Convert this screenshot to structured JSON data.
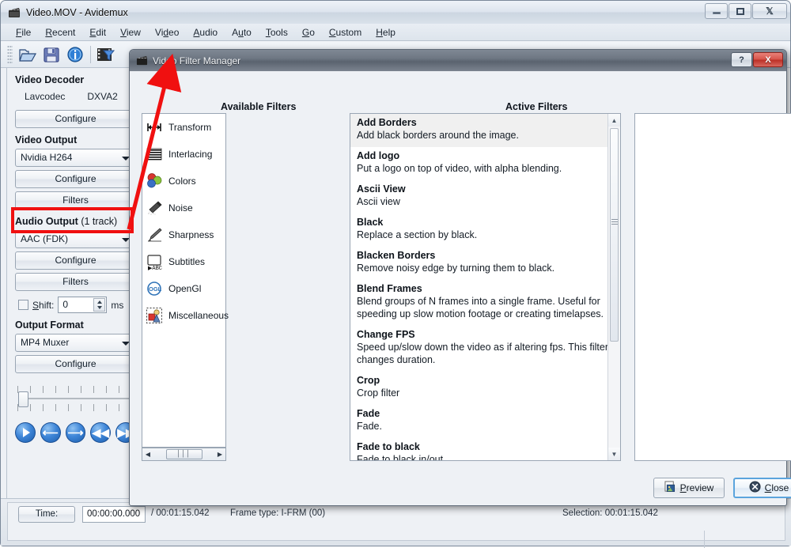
{
  "app": {
    "title": "Video.MOV - Avidemux",
    "icon": "film-clapper-icon",
    "window_buttons": {
      "minimize": "minimize-icon",
      "maximize": "maximize-icon",
      "close": "close-icon"
    },
    "menu": [
      {
        "label": "File",
        "mnemonic": "F"
      },
      {
        "label": "Recent",
        "mnemonic": "R"
      },
      {
        "label": "Edit",
        "mnemonic": "E"
      },
      {
        "label": "View",
        "mnemonic": "V"
      },
      {
        "label": "Video",
        "mnemonic": "d"
      },
      {
        "label": "Audio",
        "mnemonic": "A"
      },
      {
        "label": "Auto",
        "mnemonic": "u"
      },
      {
        "label": "Tools",
        "mnemonic": "T"
      },
      {
        "label": "Go",
        "mnemonic": "G"
      },
      {
        "label": "Custom",
        "mnemonic": "C"
      },
      {
        "label": "Help",
        "mnemonic": "H"
      }
    ],
    "toolbar": [
      {
        "name": "open-file-icon"
      },
      {
        "name": "save-file-icon"
      },
      {
        "name": "info-icon"
      },
      {
        "name": "video-filter-icon"
      }
    ]
  },
  "sidebar": {
    "video_decoder": {
      "title": "Video Decoder",
      "codec": "Lavcodec",
      "accel": "DXVA2",
      "configure_label": "Configure"
    },
    "video_output": {
      "title": "Video Output",
      "selected": "Nvidia H264",
      "configure_label": "Configure",
      "filters_label": "Filters"
    },
    "audio_output": {
      "title": "Audio Output",
      "subtitle": "(1 track)",
      "selected": "AAC (FDK)",
      "configure_label": "Configure",
      "filters_label": "Filters",
      "shift_label": "Shift:",
      "shift_value": "0",
      "shift_unit": "ms",
      "shift_checked": false
    },
    "output_format": {
      "title": "Output Format",
      "selected": "MP4 Muxer",
      "configure_label": "Configure"
    },
    "transport": [
      {
        "name": "play-button",
        "glyph": "▶"
      },
      {
        "name": "previous-frame-button",
        "glyph": "←"
      },
      {
        "name": "next-frame-button",
        "glyph": "→"
      },
      {
        "name": "rewind-button",
        "glyph": "«"
      },
      {
        "name": "forward-button",
        "glyph": "»"
      }
    ]
  },
  "statusbar": {
    "time_label": "Time:",
    "time_value": "00:00:00.000",
    "total_time": "/ 00:01:15.042",
    "frame_type": "Frame type: I-FRM (00)",
    "selection": "Selection: 00:01:15.042"
  },
  "dialog": {
    "title": "Video Filter Manager",
    "icon": "film-clapper-icon",
    "help_button": "?",
    "close_button": "X",
    "available_header": "Available Filters",
    "active_header": "Active Filters",
    "categories": [
      {
        "label": "Transform",
        "icon": "transform-icon"
      },
      {
        "label": "Interlacing",
        "icon": "interlacing-icon"
      },
      {
        "label": "Colors",
        "icon": "colors-icon"
      },
      {
        "label": "Noise",
        "icon": "noise-icon"
      },
      {
        "label": "Sharpness",
        "icon": "sharpness-icon"
      },
      {
        "label": "Subtitles",
        "icon": "subtitles-icon"
      },
      {
        "label": "OpenGl",
        "icon": "opengl-icon"
      },
      {
        "label": "Miscellaneous",
        "icon": "miscellaneous-icon"
      }
    ],
    "filters": [
      {
        "name": "Add Borders",
        "desc": "Add black borders around the image.",
        "selected": true
      },
      {
        "name": "Add logo",
        "desc": "Put a logo on top of video, with alpha blending.",
        "selected": false
      },
      {
        "name": "Ascii View",
        "desc": "Ascii view",
        "selected": false
      },
      {
        "name": "Black",
        "desc": "Replace a section by black.",
        "selected": false
      },
      {
        "name": "Blacken Borders",
        "desc": "Remove noisy edge by turning them to black.",
        "selected": false
      },
      {
        "name": "Blend Frames",
        "desc": "Blend groups of N frames into a single frame.  Useful for speeding up slow motion footage or creating timelapses.",
        "selected": false
      },
      {
        "name": "Change FPS",
        "desc": "Speed up/slow down the video as if altering fps. This filter changes duration.",
        "selected": false
      },
      {
        "name": "Crop",
        "desc": "Crop filter",
        "selected": false
      },
      {
        "name": "Fade",
        "desc": "Fade.",
        "selected": false
      },
      {
        "name": "Fade to black",
        "desc": "Fade to black in/out",
        "selected": false
      }
    ],
    "active_filters": [],
    "preview_label": "Preview",
    "preview_mnemonic": "P",
    "close_label": "Close",
    "close_mnemonic": "C"
  },
  "annotation": {
    "highlight_target": "Filters",
    "arrow_color": "#f01010",
    "box_color": "#f01010"
  }
}
